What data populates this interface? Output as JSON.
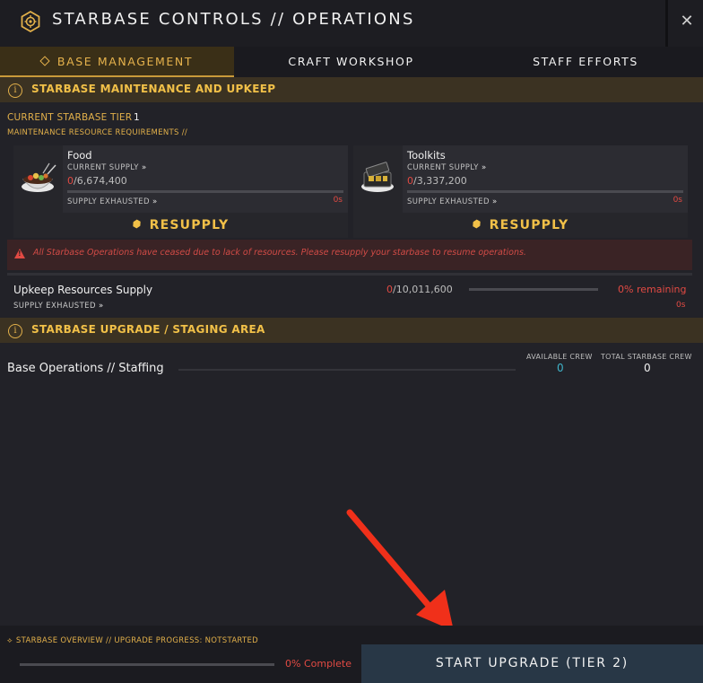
{
  "window": {
    "title": "STARBASE CONTROLS // OPERATIONS",
    "close_symbol": "✕"
  },
  "tabs": [
    {
      "label": "BASE MANAGEMENT",
      "active": true
    },
    {
      "label": "CRAFT WORKSHOP",
      "active": false
    },
    {
      "label": "STAFF EFFORTS",
      "active": false
    }
  ],
  "maintenance": {
    "section_title": "STARBASE MAINTENANCE AND UPKEEP",
    "tier_label": "CURRENT STARBASE TIER",
    "tier_value": "1",
    "requirements_label": "MAINTENANCE RESOURCE REQUIREMENTS //",
    "resources": [
      {
        "name": "Food",
        "supply_label": "CURRENT SUPPLY",
        "current": "0",
        "total": "/6,674,400",
        "exhausted_label": "SUPPLY EXHAUSTED",
        "time": "0s",
        "fill": 0,
        "resupply_label": "RESUPPLY",
        "icon": "food-pot-icon"
      },
      {
        "name": "Toolkits",
        "supply_label": "CURRENT SUPPLY",
        "current": "0",
        "total": "/3,337,200",
        "exhausted_label": "SUPPLY EXHAUSTED",
        "time": "0s",
        "fill": 0,
        "resupply_label": "RESUPPLY",
        "icon": "toolkit-case-icon"
      }
    ],
    "alert": "All Starbase Operations have ceased due to lack of resources. Please resupply your starbase to resume operations.",
    "upkeep": {
      "label": "Upkeep Resources Supply",
      "current": "0",
      "total": "/10,011,600",
      "remaining": "0% remaining",
      "exhausted_label": "SUPPLY EXHAUSTED",
      "time": "0s",
      "fill": 0
    }
  },
  "upgrade": {
    "section_title": "STARBASE UPGRADE / STAGING AREA",
    "staffing_label": "Base Operations // Staffing",
    "available_crew_label": "AVAILABLE CREW",
    "available_crew_value": "0",
    "total_crew_label": "TOTAL STARBASE CREW",
    "total_crew_value": "0"
  },
  "footer": {
    "overview_label": "STARBASE OVERVIEW // UPGRADE PROGRESS: NOTSTARTED",
    "progress_text": "0% Complete",
    "progress": 0,
    "start_button": "START UPGRADE (TIER 2)"
  },
  "colors": {
    "accent_gold": "#f1c048",
    "alert_red": "#e24a43",
    "crew_cyan": "#3fb3c9",
    "button_bg": "#283746"
  }
}
